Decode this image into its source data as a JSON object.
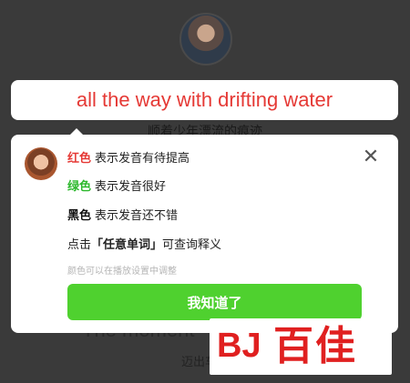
{
  "background": {
    "subtitle": "顺着少年漂流的痕迹",
    "line2": "The moment",
    "line3": "迈出车站"
  },
  "sentence": {
    "text": "all the way with drifting water",
    "color": "#e53935"
  },
  "popup": {
    "rows": [
      {
        "color_word": "红色",
        "color": "#e53935",
        "desc": "表示发音有待提高"
      },
      {
        "color_word": "绿色",
        "color": "#2db82d",
        "desc": "表示发音很好"
      },
      {
        "color_word": "黑色",
        "color": "#111111",
        "desc": "表示发音还不错"
      }
    ],
    "tap_prefix": "点击",
    "tap_highlight": "「任意单词」",
    "tap_suffix": "可查询释义",
    "hint": "颜色可以在播放设置中调整",
    "ok_label": "我知道了",
    "close_icon": "close-icon",
    "accent": "#4fd12f"
  },
  "watermark": {
    "mark": "BJ",
    "text": "百佳"
  }
}
